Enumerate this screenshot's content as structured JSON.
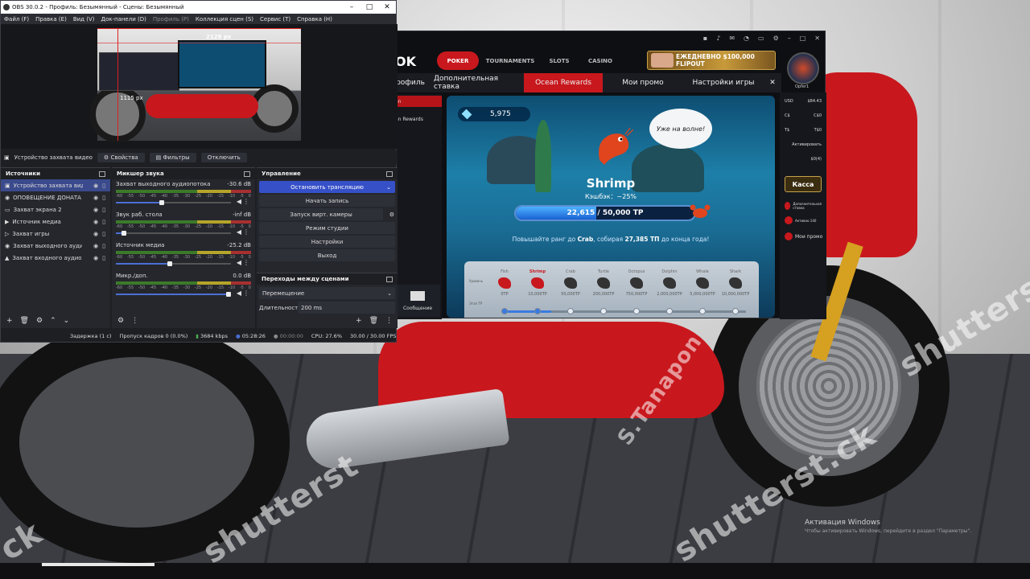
{
  "obs": {
    "title": "OBS 30.0.2 - Профиль: Безымянный - Сцены: Безымянный",
    "menu": [
      "Файл (F)",
      "Правка (E)",
      "Вид (V)",
      "Док-панели (D)",
      "Профиль (P)",
      "Коллекция сцен (S)",
      "Сервис (T)",
      "Справка (H)"
    ],
    "preview": {
      "width_label": "2128 px",
      "height_label": "1115 px"
    },
    "source_toolbar": {
      "current": "Устройство захвата видео",
      "properties": "Свойства",
      "filters": "Фильтры",
      "deactivate": "Отключить"
    },
    "sources": {
      "title": "Источники",
      "items": [
        "Устройство захвата видео",
        "ОПОВЕЩЕНИЕ ДОНАТА",
        "Захват экрана 2",
        "Источник медиа",
        "Захват игры",
        "Захват выходного аудиопо",
        "Захват входного аудиопото"
      ]
    },
    "mixer": {
      "title": "Микшер звука",
      "ticks": [
        "-60",
        "-55",
        "-50",
        "-45",
        "-40",
        "-35",
        "-30",
        "-25",
        "-20",
        "-15",
        "-10",
        "-5",
        "0"
      ],
      "channels": [
        {
          "name": "Захват выходного аудиопотока",
          "level": "-30.6 dB",
          "volume": 0.38
        },
        {
          "name": "Звук раб. стола",
          "level": "-inf dB",
          "volume": 0.05
        },
        {
          "name": "Источник медиа",
          "level": "-25.2 dB",
          "volume": 0.45
        },
        {
          "name": "Микр./доп.",
          "level": "0.0 dB",
          "volume": 1.0
        }
      ]
    },
    "controls": {
      "title": "Управление",
      "stop_stream": "Остановить трансляцию",
      "start_record": "Начать запись",
      "virtual_cam": "Запуск вирт. камеры",
      "studio_mode": "Режим студии",
      "settings": "Настройки",
      "exit": "Выход"
    },
    "transitions": {
      "title": "Переходы между сценами",
      "type": "Перемещение",
      "duration_label": "Длительность",
      "duration": "200 ms"
    },
    "status": {
      "delay": "Задержка (1 с)",
      "dropped": "Пропуск кадров 0 (0.0%)",
      "bitrate": "3684 kbps",
      "live_time": "05:28:26",
      "rec_time": "00:00:00",
      "cpu": "CPU: 27.6%",
      "fps": "30.00 / 30.00 FPS"
    }
  },
  "poker": {
    "logo": "OK",
    "nav": [
      "POKER",
      "TOURNAMENTS",
      "SLOTS",
      "CASINO"
    ],
    "banner": "ЕЖЕДНЕВНО $100,000 FLIPOUT",
    "username": "Opfer1",
    "subtabs": [
      "рофиль",
      "Дополнительная ставка",
      "Ocean Rewards",
      "Мои промо",
      "Настройки игры"
    ],
    "left_menu": [
      "an",
      "an Rewards"
    ],
    "message_label": "Сообщение",
    "rewards": {
      "gems": "5,975",
      "speech": "Уже на волне!",
      "rank_name": "Shrimp",
      "cashback": "Кэшбэк：~25%",
      "progress_text": "22,615 / 50,000 TP",
      "progress": 0.4523,
      "hint_pre": "Повышайте ранг до",
      "hint_rank": "Crab",
      "hint_mid": ", собирая",
      "hint_amount": "27,385 ТП",
      "hint_post": "до конца года!",
      "row_labels": [
        "Уровень",
        "Этап ТР"
      ],
      "levels": [
        {
          "name": "Fish",
          "tp": "0TP"
        },
        {
          "name": "Shrimp",
          "tp": "10,000TP"
        },
        {
          "name": "Crab",
          "tp": "50,000TP"
        },
        {
          "name": "Turtle",
          "tp": "200,000TP"
        },
        {
          "name": "Octopus",
          "tp": "750,000TP"
        },
        {
          "name": "Dolphin",
          "tp": "2,000,000TP"
        },
        {
          "name": "Whale",
          "tp": "5,000,000TP"
        },
        {
          "name": "Shark",
          "tp": "10,000,000TP"
        }
      ]
    },
    "balances": [
      {
        "cur": "USD",
        "val": "$84.43"
      },
      {
        "cur": "C$",
        "val": "C$0"
      },
      {
        "cur": "T$",
        "val": "T$0"
      },
      {
        "cur": "",
        "val": "Активировать"
      },
      {
        "cur": "",
        "val": "$0(4)"
      }
    ],
    "cashier": "Касса",
    "promos": [
      "Дополнительная ставка",
      "Активно 140",
      "Мои промо"
    ]
  },
  "watermarks": [
    "shutterst",
    "S.Tanapon",
    "shutterst.ck",
    "shutterst.ck",
    "ck"
  ],
  "windows": {
    "activate_title": "Активация Windows",
    "activate_sub": "Чтобы активировать Windows, перейдите в раздел \"Параметры\"."
  },
  "colors": {
    "accent_red": "#c8181d",
    "obs_blue": "#3650c8",
    "gold": "#c9a24a"
  }
}
